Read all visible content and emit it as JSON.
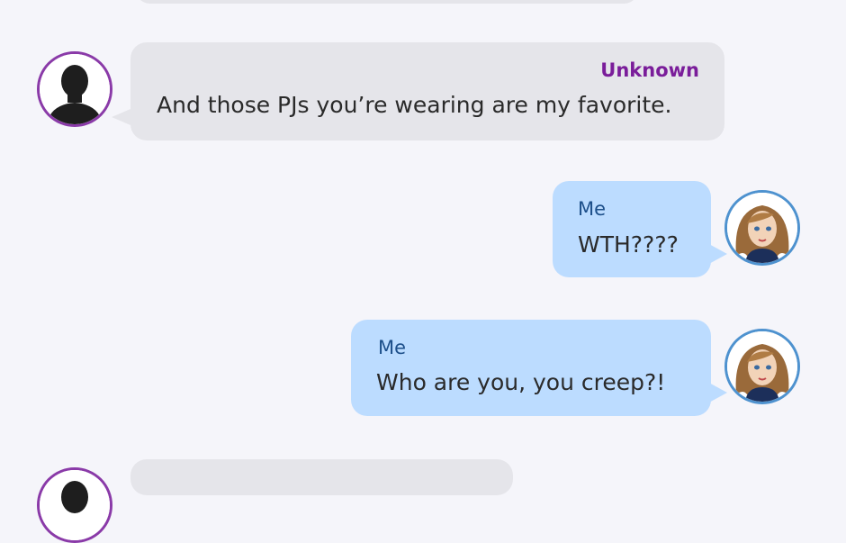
{
  "colors": {
    "background": "#f5f5fa",
    "incoming_bubble": "#e5e5ea",
    "outgoing_bubble": "#bcdcff",
    "unknown_name": "#7a1d9a",
    "me_name": "#1d4f8a",
    "unknown_ring": "#8a3aa8",
    "me_ring": "#4e92cf"
  },
  "messages": [
    {
      "sender": "Unknown",
      "text": "And those PJs you’re wearing are my favorite.",
      "side": "incoming",
      "avatar_icon": "silhouette-avatar-icon"
    },
    {
      "sender": "Me",
      "text": "WTH????",
      "side": "outgoing",
      "avatar_icon": "girl-avatar-icon"
    },
    {
      "sender": "Me",
      "text": "Who are you, you creep?!",
      "side": "outgoing",
      "avatar_icon": "girl-avatar-icon"
    }
  ]
}
